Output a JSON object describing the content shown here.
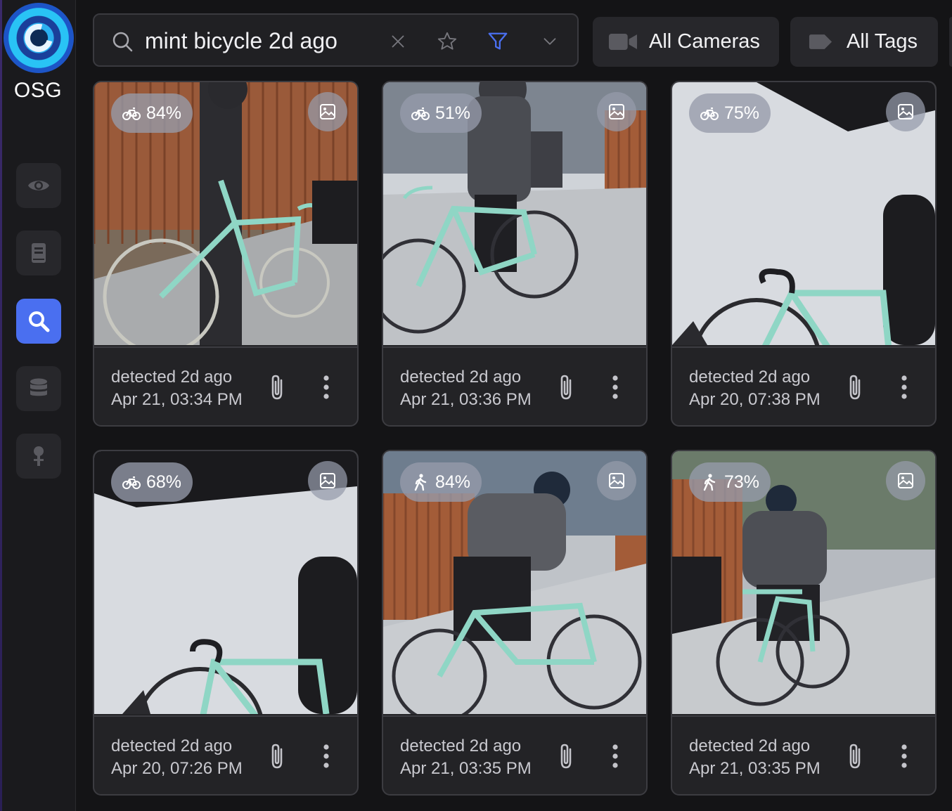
{
  "app": {
    "logo_text": "OSG"
  },
  "sidebar": {
    "items": [
      {
        "name": "live",
        "icon": "eye-icon",
        "active": false
      },
      {
        "name": "review",
        "icon": "book-icon",
        "active": false
      },
      {
        "name": "search",
        "icon": "search-icon",
        "active": true
      },
      {
        "name": "storage",
        "icon": "database-icon",
        "active": false
      },
      {
        "name": "pin",
        "icon": "pin-icon",
        "active": false
      }
    ]
  },
  "search": {
    "value": "mint bicycle 2d ago",
    "placeholder": "Search"
  },
  "filters": {
    "cameras_label": "All Cameras",
    "tags_label": "All Tags"
  },
  "colors": {
    "accent": "#4a6ff0",
    "filter_icon": "#4a6ff0"
  },
  "results": [
    {
      "icon": "bicycle-icon",
      "score": "84%",
      "detected": "detected 2d ago",
      "time": "Apr 21, 03:34 PM"
    },
    {
      "icon": "bicycle-icon",
      "score": "51%",
      "detected": "detected 2d ago",
      "time": "Apr 21, 03:36 PM"
    },
    {
      "icon": "bicycle-icon",
      "score": "75%",
      "detected": "detected 2d ago",
      "time": "Apr 20, 07:38 PM"
    },
    {
      "icon": "bicycle-icon",
      "score": "68%",
      "detected": "detected 2d ago",
      "time": "Apr 20, 07:26 PM"
    },
    {
      "icon": "person-walking-icon",
      "score": "84%",
      "detected": "detected 2d ago",
      "time": "Apr 21, 03:35 PM"
    },
    {
      "icon": "person-walking-icon",
      "score": "73%",
      "detected": "detected 2d ago",
      "time": "Apr 21, 03:35 PM"
    }
  ]
}
